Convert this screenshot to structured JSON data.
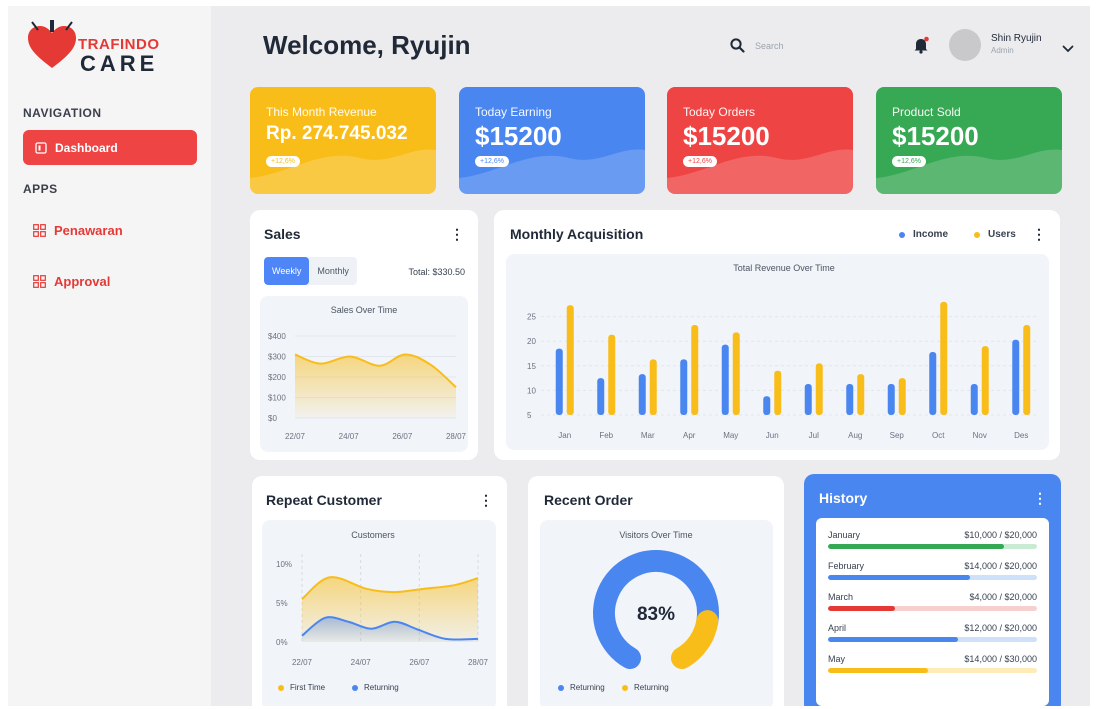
{
  "brand": {
    "line1": "TRAFINDO",
    "line2": "CARE"
  },
  "nav": {
    "section_nav": "NAVIGATION",
    "dashboard_label": "Dashboard",
    "section_apps": "APPS",
    "apps": [
      {
        "label": "Penawaran"
      },
      {
        "label": "Approval"
      }
    ]
  },
  "header": {
    "welcome": "Welcome, Ryujin",
    "search_placeholder": "Search",
    "user_name": "Shin Ryujin",
    "user_role": "Admin"
  },
  "stats": [
    {
      "label": "This Month Revenue",
      "value": "Rp. 274.745.032",
      "badge": "+12,6%",
      "color": "#f9bd1a"
    },
    {
      "label": "Today Earning",
      "value": "$15200",
      "badge": "+12,6%",
      "color": "#4a86f0"
    },
    {
      "label": "Today Orders",
      "value": "$15200",
      "badge": "+12,6%",
      "color": "#ef4444"
    },
    {
      "label": "Product Sold",
      "value": "$15200",
      "badge": "+12,6%",
      "color": "#37a853"
    }
  ],
  "sales": {
    "title": "Sales",
    "tab_weekly": "Weekly",
    "tab_monthly": "Monthly",
    "total": "Total: $330.50"
  },
  "acquisition": {
    "title": "Monthly Acquisition",
    "legend_income": "Income",
    "legend_users": "Users"
  },
  "repeat": {
    "title": "Repeat Customer",
    "legend_first": "First Time",
    "legend_returning": "Returning"
  },
  "recent": {
    "title": "Recent Order",
    "legend_a": "Returning",
    "legend_b": "Returning"
  },
  "history": {
    "title": "History",
    "rows": [
      {
        "month": "January",
        "value": "$10,000 / $20,000",
        "fraction": 0.84,
        "color": "#34a853",
        "track": "#c9ebd3"
      },
      {
        "month": "February",
        "value": "$14,000 / $20,000",
        "fraction": 0.68,
        "color": "#4a86f0",
        "track": "#cfe0fb"
      },
      {
        "month": "March",
        "value": "$4,000 / $20,000",
        "fraction": 0.32,
        "color": "#e53935",
        "track": "#f6cfcf"
      },
      {
        "month": "April",
        "value": "$12,000 / $20,000",
        "fraction": 0.62,
        "color": "#4a86f0",
        "track": "#cfe0fb"
      },
      {
        "month": "May",
        "value": "$14,000 / $30,000",
        "fraction": 0.48,
        "color": "#f9bd1a",
        "track": "#fdecb8"
      }
    ]
  },
  "colors": {
    "blue": "#4a86f0",
    "yellow": "#f9bd1a",
    "red": "#ef4444",
    "green": "#37a853"
  },
  "chart_data": [
    {
      "type": "area",
      "title": "Sales Over Time",
      "x": [
        "22/07",
        "24/07",
        "26/07",
        "28/07"
      ],
      "y_ticks": [
        "$400",
        "$300",
        "$200",
        "$100",
        "$0"
      ],
      "ylim": [
        0,
        400
      ],
      "series": [
        {
          "name": "",
          "points": [
            [
              0,
              310
            ],
            [
              0.6,
              265
            ],
            [
              1.3,
              300
            ],
            [
              2.0,
              255
            ],
            [
              2.6,
              310
            ],
            [
              3.2,
              260
            ],
            [
              3.8,
              150
            ]
          ]
        }
      ]
    },
    {
      "type": "bar",
      "title": "Total Revenue Over Time",
      "categories": [
        "Jan",
        "Feb",
        "Mar",
        "Apr",
        "May",
        "Jun",
        "Jul",
        "Aug",
        "Sep",
        "Oct",
        "Nov",
        "Des"
      ],
      "y_ticks": [
        25,
        20,
        15,
        10,
        5
      ],
      "ylim": [
        5,
        30
      ],
      "series": [
        {
          "name": "Income",
          "color": "#4a86f0",
          "values": [
            18.5,
            12.5,
            13.3,
            16.3,
            19.3,
            8.8,
            11.3,
            11.3,
            11.3,
            17.8,
            11.3,
            20.3
          ]
        },
        {
          "name": "Users",
          "color": "#f9bd1a",
          "values": [
            27.3,
            21.3,
            16.3,
            23.3,
            21.8,
            14.0,
            15.5,
            13.3,
            12.5,
            28.0,
            19.0,
            23.3
          ]
        }
      ]
    },
    {
      "type": "area",
      "title": "Customers",
      "x": [
        "22/07",
        "24/07",
        "26/07",
        "28/07"
      ],
      "y_ticks": [
        "10%",
        "5%",
        "0%"
      ],
      "ylim": [
        0,
        10
      ],
      "series": [
        {
          "name": "First Time",
          "color": "#f9bd1a",
          "points": [
            [
              0,
              5.5
            ],
            [
              0.6,
              8.3
            ],
            [
              1.4,
              6.8
            ],
            [
              2.0,
              6.4
            ],
            [
              2.6,
              6.8
            ],
            [
              3.3,
              7.3
            ],
            [
              3.8,
              8.2
            ]
          ]
        },
        {
          "name": "Returning",
          "color": "#4a86f0",
          "points": [
            [
              0,
              0.8
            ],
            [
              0.5,
              3.1
            ],
            [
              1.0,
              2.6
            ],
            [
              1.5,
              1.7
            ],
            [
              2.0,
              2.6
            ],
            [
              2.5,
              1.6
            ],
            [
              3.1,
              0.4
            ],
            [
              3.8,
              0.4
            ]
          ]
        }
      ]
    },
    {
      "type": "pie",
      "title": "Visitors Over Time",
      "center_label": "83%",
      "series": [
        {
          "name": "Returning",
          "color": "#4a86f0",
          "value": 83
        },
        {
          "name": "Returning",
          "color": "#f9bd1a",
          "value": 17
        }
      ]
    }
  ]
}
